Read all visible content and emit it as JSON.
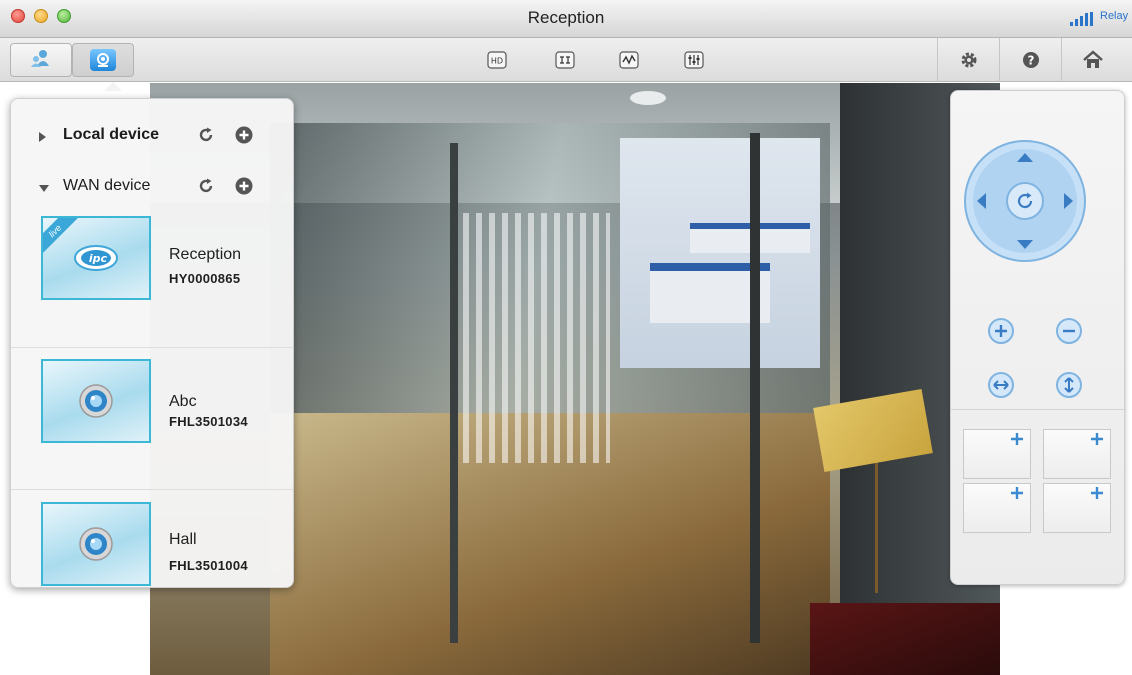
{
  "window": {
    "title": "Reception",
    "signal_label": "Relay"
  },
  "toolbar": {
    "left_icons": [
      "device-manager-icon",
      "camera-view-icon"
    ],
    "center_icons": [
      "hd-icon",
      "display-mode-icon",
      "waveform-icon",
      "equalizer-icon"
    ],
    "right_icons": [
      "gear-icon",
      "help-icon",
      "home-icon"
    ]
  },
  "devices": {
    "local_section": {
      "label": "Local device",
      "expanded": false
    },
    "wan_section": {
      "label": "WAN device",
      "expanded": true
    },
    "items": [
      {
        "name": "Reception",
        "serial": "HY0000865",
        "thumb": "live-ipc-icon",
        "badge": "live"
      },
      {
        "name": "Abc",
        "serial": "FHL3501034",
        "thumb": "camera-lens-icon"
      },
      {
        "name": "Hall",
        "serial": "FHL3501004",
        "thumb": "camera-lens-icon"
      }
    ]
  },
  "ptz": {
    "dpad": [
      "up-arrow-icon",
      "left-arrow-icon",
      "right-arrow-icon",
      "down-arrow-icon",
      "refresh-center-icon"
    ],
    "zoom": [
      "zoom-in-icon",
      "zoom-out-icon"
    ],
    "scan": [
      "horizontal-scan-icon",
      "vertical-scan-icon"
    ],
    "presets": [
      "add-preset-icon",
      "add-preset-icon",
      "add-preset-icon",
      "add-preset-icon"
    ]
  },
  "colors": {
    "accent": "#2a8ee0",
    "thumb_border": "#3cb7d6",
    "ptz_blue": "#7fb9ec"
  }
}
